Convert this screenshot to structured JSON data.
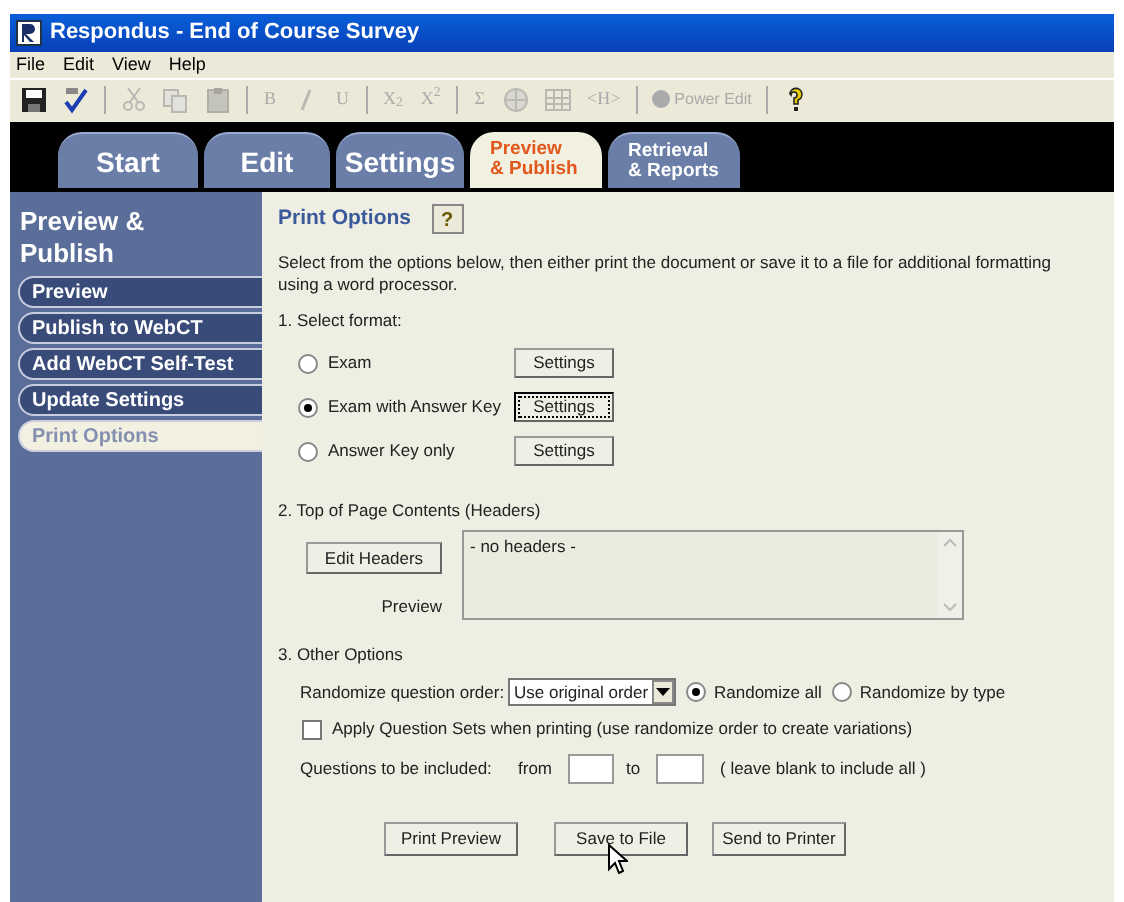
{
  "window": {
    "title": "Respondus - End of Course Survey"
  },
  "menu": [
    "File",
    "Edit",
    "View",
    "Help"
  ],
  "toolbar": [
    {
      "kind": "save",
      "disabled": false
    },
    {
      "kind": "spell",
      "disabled": false
    },
    {
      "kind": "separator"
    },
    {
      "kind": "cut",
      "disabled": true
    },
    {
      "kind": "copy",
      "disabled": true
    },
    {
      "kind": "paste",
      "disabled": true
    },
    {
      "kind": "separator"
    },
    {
      "kind": "glyph",
      "text": "B",
      "disabled": true
    },
    {
      "kind": "italic",
      "disabled": true
    },
    {
      "kind": "glyph",
      "text": "U",
      "disabled": true
    },
    {
      "kind": "separator"
    },
    {
      "kind": "glyph",
      "text": "X$_{2}$",
      "disabled": true
    },
    {
      "kind": "glyph",
      "text": "X$^{2}$",
      "disabled": true
    },
    {
      "kind": "separator"
    },
    {
      "kind": "glyph",
      "text": "Σ",
      "disabled": true
    },
    {
      "kind": "globe",
      "disabled": true
    },
    {
      "kind": "grid",
      "disabled": true
    },
    {
      "kind": "glyph",
      "text": "<H>",
      "disabled": true
    },
    {
      "kind": "separator"
    },
    {
      "kind": "button",
      "text": "Power Edit",
      "disabled": true
    },
    {
      "kind": "separator"
    },
    {
      "kind": "help",
      "disabled": false
    }
  ],
  "tabs": [
    {
      "lines": [
        "Start"
      ],
      "selected": false
    },
    {
      "lines": [
        "Edit"
      ],
      "selected": false
    },
    {
      "lines": [
        "Settings"
      ],
      "selected": false
    },
    {
      "lines": [
        "Preview",
        "& Publish"
      ],
      "selected": true
    },
    {
      "lines": [
        "Retrieval",
        "& Reports"
      ],
      "selected": false
    }
  ],
  "sidebar": {
    "title": "Preview & Publish",
    "items": [
      {
        "label": "Preview",
        "selected": false
      },
      {
        "label": "Publish to WebCT",
        "selected": false
      },
      {
        "label": "Add WebCT Self-Test",
        "selected": false
      },
      {
        "label": "Update Settings",
        "selected": false
      },
      {
        "label": "Print Options",
        "selected": true
      }
    ]
  },
  "content": {
    "heading": "Print Options",
    "help": "?",
    "intro": "Select from the options below, then either print the document or save it to a file for additional formatting using a word processor.",
    "format": {
      "title": "1.  Select format:",
      "options": [
        {
          "label": "Exam",
          "selected": false,
          "button": "Settings",
          "focused": false
        },
        {
          "label": "Exam with Answer Key",
          "selected": true,
          "button": "Settings",
          "focused": true
        },
        {
          "label": "Answer Key only",
          "selected": false,
          "button": "Settings",
          "focused": false
        }
      ]
    },
    "headers": {
      "title": "2.  Top of Page Contents (Headers)",
      "button": "Edit Headers",
      "preview_label": "Preview",
      "text": "- no headers -"
    },
    "other": {
      "title": "3.  Other Options",
      "randomize_label": "Randomize question order:",
      "select_value": "Use original order",
      "radios": [
        {
          "label": "Randomize all",
          "selected": true
        },
        {
          "label": "Randomize by type",
          "selected": false
        }
      ],
      "checkbox": {
        "label": "Apply Question Sets when printing (use randomize order to create variations)",
        "checked": false
      },
      "questions_label": "Questions to be included:",
      "from_label": "from",
      "to_label": "to",
      "hint": "( leave blank to include all )"
    },
    "actions": [
      "Print Preview",
      "Save to File",
      "Send to Printer"
    ]
  }
}
